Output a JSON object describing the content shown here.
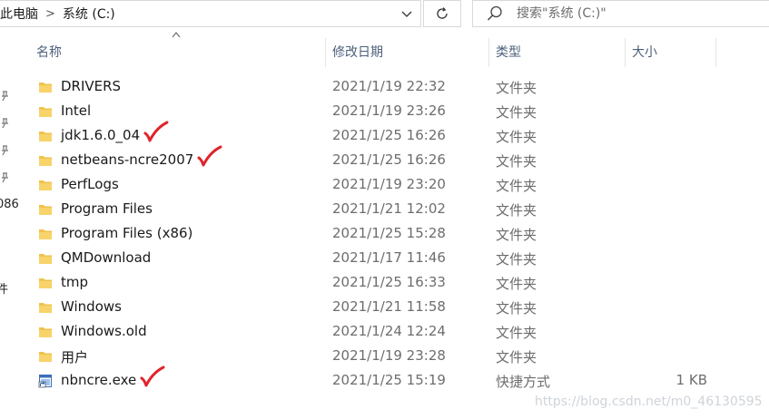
{
  "breadcrumb": {
    "root": "此电脑",
    "separator": ">",
    "current": "系统 (C:)"
  },
  "search": {
    "placeholder": "搜索\"系统 (C:)\""
  },
  "nav": {
    "fragment_1": "086",
    "fragment_2": "件"
  },
  "columns": {
    "name": "名称",
    "modified": "修改日期",
    "type": "类型",
    "size": "大小"
  },
  "sort": {
    "column": "name",
    "direction": "ascending"
  },
  "colors": {
    "folder": "#f0c24b",
    "header_text": "#4c607a",
    "check_mark": "#e0242b"
  },
  "files": [
    {
      "name": "DRIVERS",
      "modified": "2021/1/19 22:32",
      "type": "文件夹",
      "size": "",
      "icon": "folder-icon",
      "checked": false
    },
    {
      "name": "Intel",
      "modified": "2021/1/19 23:26",
      "type": "文件夹",
      "size": "",
      "icon": "folder-icon",
      "checked": false
    },
    {
      "name": "jdk1.6.0_04",
      "modified": "2021/1/25 16:26",
      "type": "文件夹",
      "size": "",
      "icon": "folder-icon",
      "checked": true
    },
    {
      "name": "netbeans-ncre2007",
      "modified": "2021/1/25 16:26",
      "type": "文件夹",
      "size": "",
      "icon": "folder-icon",
      "checked": true
    },
    {
      "name": "PerfLogs",
      "modified": "2021/1/19 23:20",
      "type": "文件夹",
      "size": "",
      "icon": "folder-icon",
      "checked": false
    },
    {
      "name": "Program Files",
      "modified": "2021/1/21 12:02",
      "type": "文件夹",
      "size": "",
      "icon": "folder-icon",
      "checked": false
    },
    {
      "name": "Program Files (x86)",
      "modified": "2021/1/25 15:28",
      "type": "文件夹",
      "size": "",
      "icon": "folder-icon",
      "checked": false
    },
    {
      "name": "QMDownload",
      "modified": "2021/1/17 11:46",
      "type": "文件夹",
      "size": "",
      "icon": "folder-icon",
      "checked": false
    },
    {
      "name": "tmp",
      "modified": "2021/1/25 16:33",
      "type": "文件夹",
      "size": "",
      "icon": "folder-icon",
      "checked": false
    },
    {
      "name": "Windows",
      "modified": "2021/1/21 11:58",
      "type": "文件夹",
      "size": "",
      "icon": "folder-icon",
      "checked": false
    },
    {
      "name": "Windows.old",
      "modified": "2021/1/24 12:24",
      "type": "文件夹",
      "size": "",
      "icon": "folder-icon",
      "checked": false
    },
    {
      "name": "用户",
      "modified": "2021/1/19 23:28",
      "type": "文件夹",
      "size": "",
      "icon": "folder-icon",
      "checked": false
    },
    {
      "name": "nbncre.exe",
      "modified": "2021/1/25 15:19",
      "type": "快捷方式",
      "size": "1 KB",
      "icon": "shortcut-icon",
      "checked": true
    }
  ],
  "watermark": "https://blog.csdn.net/m0_46130595"
}
